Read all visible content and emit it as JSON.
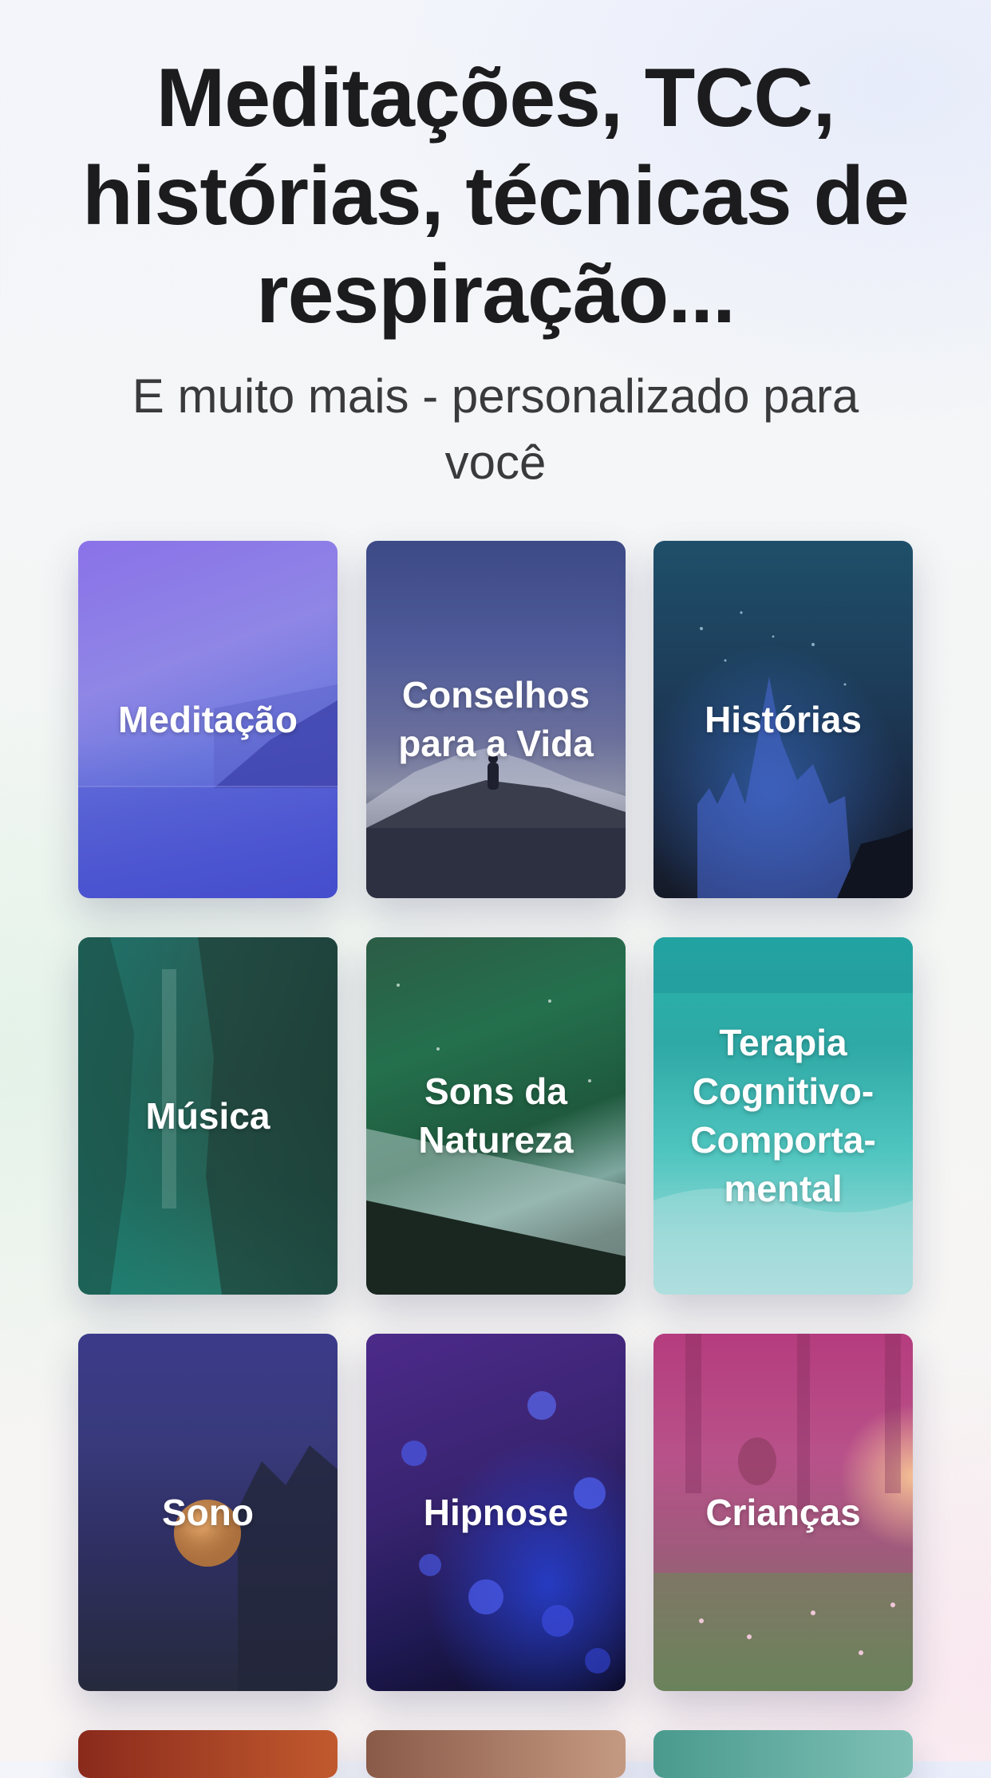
{
  "header": {
    "title": "Meditações, TCC, histórias, técnicas de respiração...",
    "subtitle": "E muito mais - personalizado para você"
  },
  "categories": [
    {
      "label": "Meditação",
      "image": "lake-mountain-purple"
    },
    {
      "label": "Conselhos\npara a Vida",
      "image": "person-mountain-night"
    },
    {
      "label": "Histórias",
      "image": "castle-fireworks"
    },
    {
      "label": "Música",
      "image": "forest-waterfall"
    },
    {
      "label": "Sons da\nNatureza",
      "image": "rain-on-wood"
    },
    {
      "label": "Terapia\nCognitivo-\nComporta-\nmental",
      "image": "underwater-turquoise"
    },
    {
      "label": "Sono",
      "image": "moon-trees-night"
    },
    {
      "label": "Hipnose",
      "image": "blue-flowers"
    },
    {
      "label": "Crianças",
      "image": "child-sunset-meadow"
    }
  ],
  "colors": {
    "title": "#1c1c1e",
    "subtitle": "#3a3a3c",
    "card_text": "#ffffff"
  }
}
